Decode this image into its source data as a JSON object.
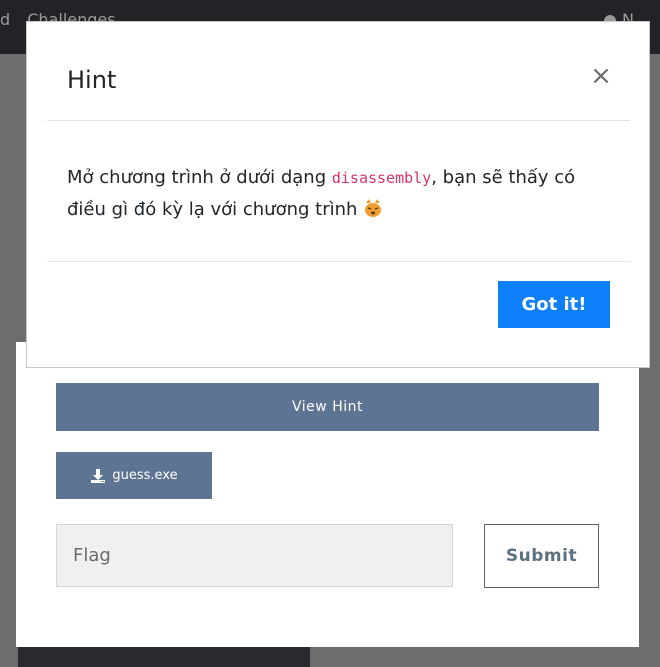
{
  "topbar": {
    "nav_items": [
      "d",
      "Challenges"
    ],
    "right_label": "N"
  },
  "challenge": {
    "view_hint_label": "View Hint",
    "download_label": "guess.exe",
    "flag_placeholder": "Flag",
    "submit_label": "Submit"
  },
  "modal": {
    "title": "Hint",
    "close_glyph": "×",
    "body_before": "Mở chương trình ở dưới dạng ",
    "body_code": "disassembly",
    "body_after": ", bạn sẽ thấy có điều gì đó kỳ lạ với chương trình ",
    "confirm_label": "Got it!"
  },
  "colors": {
    "primary": "#0d7ff8",
    "slate_button": "#5d7492",
    "code_pink": "#d6336c"
  }
}
